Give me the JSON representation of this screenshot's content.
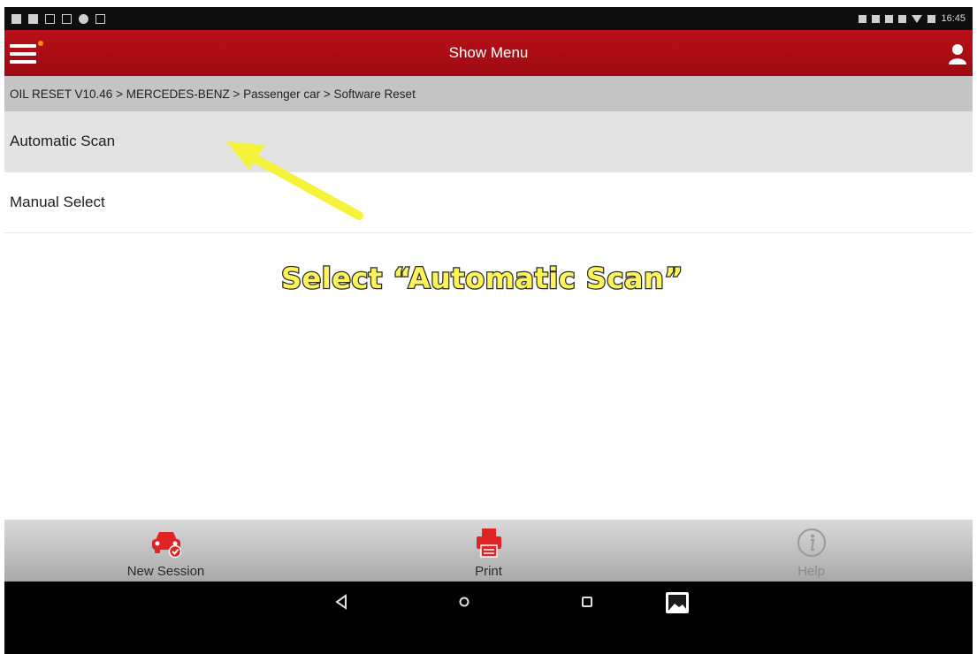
{
  "status_bar": {
    "time": "16:45"
  },
  "app_bar": {
    "title": "Show Menu"
  },
  "breadcrumb": {
    "text": "OIL RESET V10.46 > MERCEDES-BENZ > Passenger car > Software Reset"
  },
  "menu": {
    "items": [
      {
        "label": "Automatic Scan",
        "selected": true
      },
      {
        "label": "Manual Select",
        "selected": false
      }
    ]
  },
  "annotation": {
    "caption": "Select “Automatic Scan”",
    "color": "#fff35a"
  },
  "toolbar": {
    "new_session_label": "New Session",
    "print_label": "Print",
    "help_label": "Help"
  },
  "colors": {
    "brand_red": "#b8101a",
    "icon_red": "#e02424"
  },
  "icons": {
    "menu": "hamburger-icon",
    "user": "user-icon",
    "new_session": "car-check-icon",
    "print": "printer-icon",
    "help": "info-icon",
    "back": "back-triangle-icon",
    "home": "home-circle-icon",
    "recents": "recents-square-icon",
    "screenshot": "image-icon"
  }
}
